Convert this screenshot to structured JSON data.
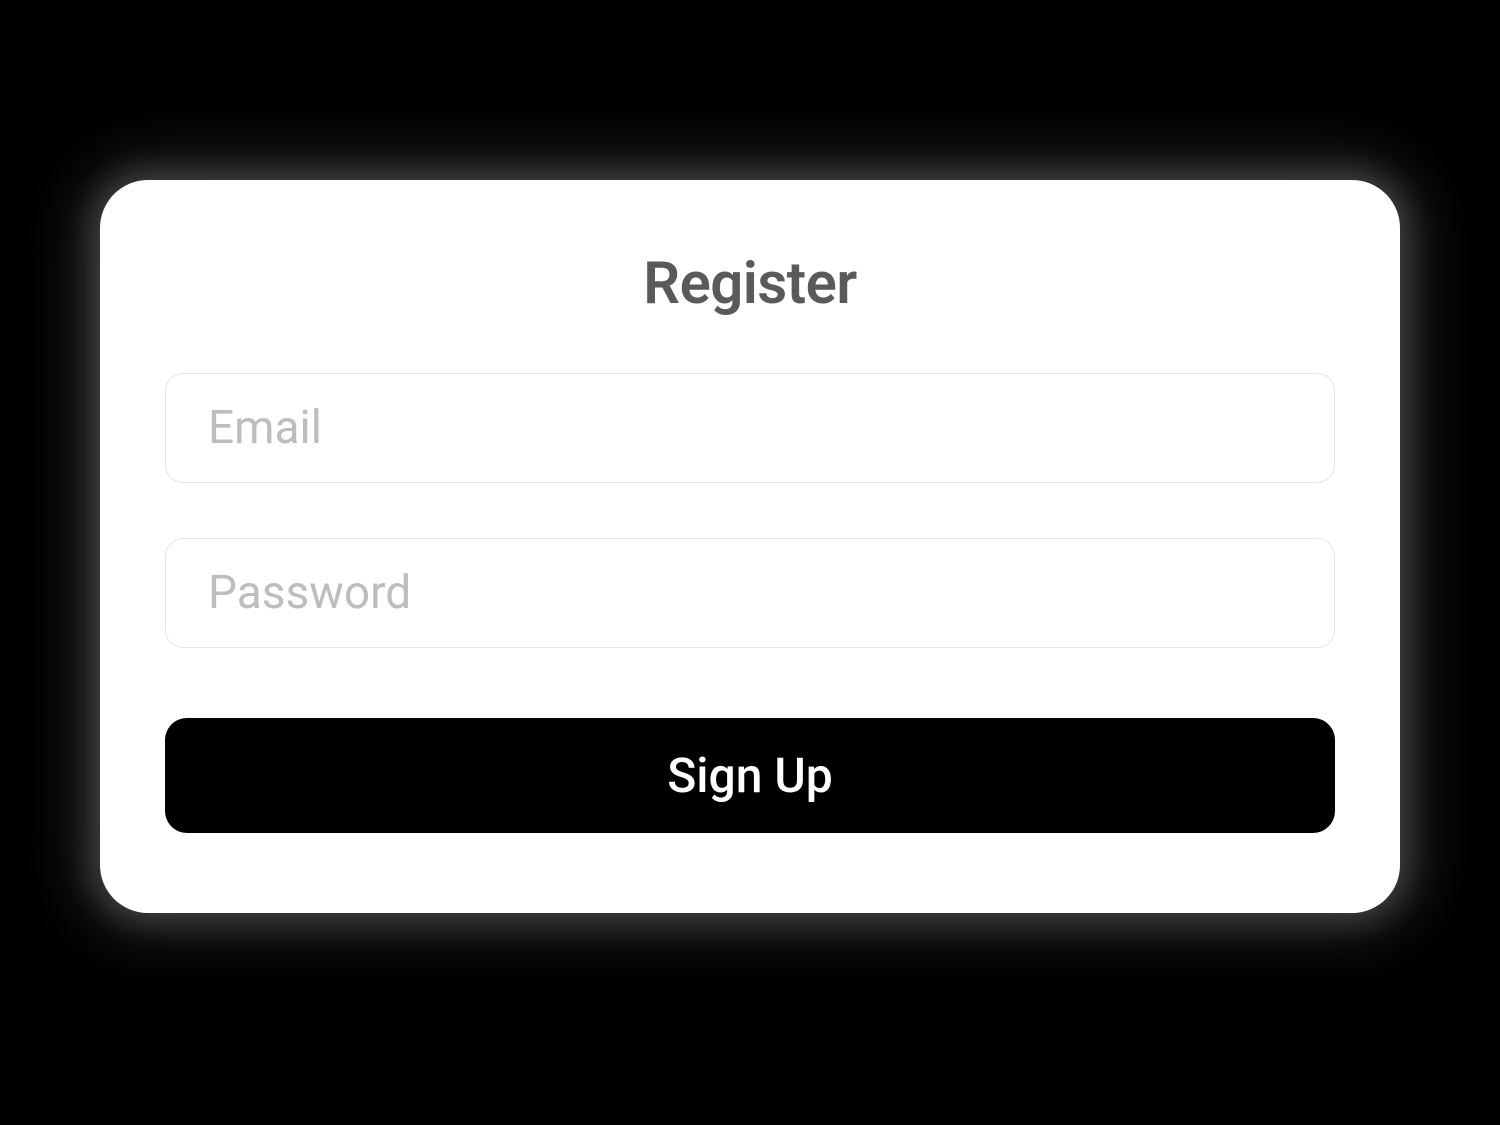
{
  "form": {
    "title": "Register",
    "email": {
      "placeholder": "Email",
      "value": ""
    },
    "password": {
      "placeholder": "Password",
      "value": ""
    },
    "submit_label": "Sign Up"
  }
}
